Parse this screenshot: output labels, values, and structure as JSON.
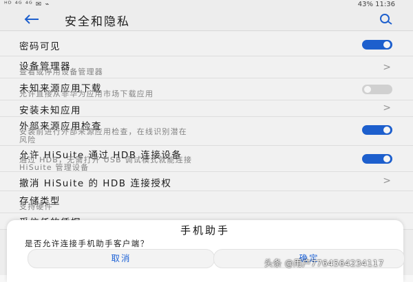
{
  "status_bar": {
    "left": "ᴴᴰ ⁴ᴳ ⁴ᴳ ✉ ⌁",
    "right": "43% 11:36"
  },
  "app_bar": {
    "title": "安全和隐私"
  },
  "rows": [
    {
      "title": "密码可见",
      "switch": "on"
    },
    {
      "title": "设备管理器",
      "subtitle": "查看或停用设备管理器",
      "chevron": ">"
    },
    {
      "title": "未知来源应用下载",
      "subtitle": "允许直接从非华为应用市场下载应用",
      "switch": "off"
    },
    {
      "title": "安装未知应用",
      "chevron": ">"
    },
    {
      "title": "外部来源应用检查",
      "subtitle_lines": [
        "安装前进行外部来源应用检查，在线识别潜在",
        "风险"
      ],
      "switch": "on"
    },
    {
      "title": "允许 HiSuite 通过 HDB 连接设备",
      "subtitle_lines": [
        "通过 HDB，无需打开 USB 调试模式就能连接",
        "HiSuite 管理设备"
      ],
      "switch": "on"
    },
    {
      "title": "撤消 HiSuite 的 HDB 连接授权",
      "chevron": ">"
    },
    {
      "title": "存储类型",
      "subtitle": "支持硬件"
    },
    {
      "title": "受信任的凭据"
    }
  ],
  "dialog": {
    "title": "手机助手",
    "message": "是否允许连接手机助手客户端？",
    "cancel_label": "取消",
    "confirm_label": "确定"
  },
  "watermark": "头条 @用户7764564234117",
  "colors": {
    "accent": "#1f63d6",
    "switch_off": "#d9d9d9"
  }
}
